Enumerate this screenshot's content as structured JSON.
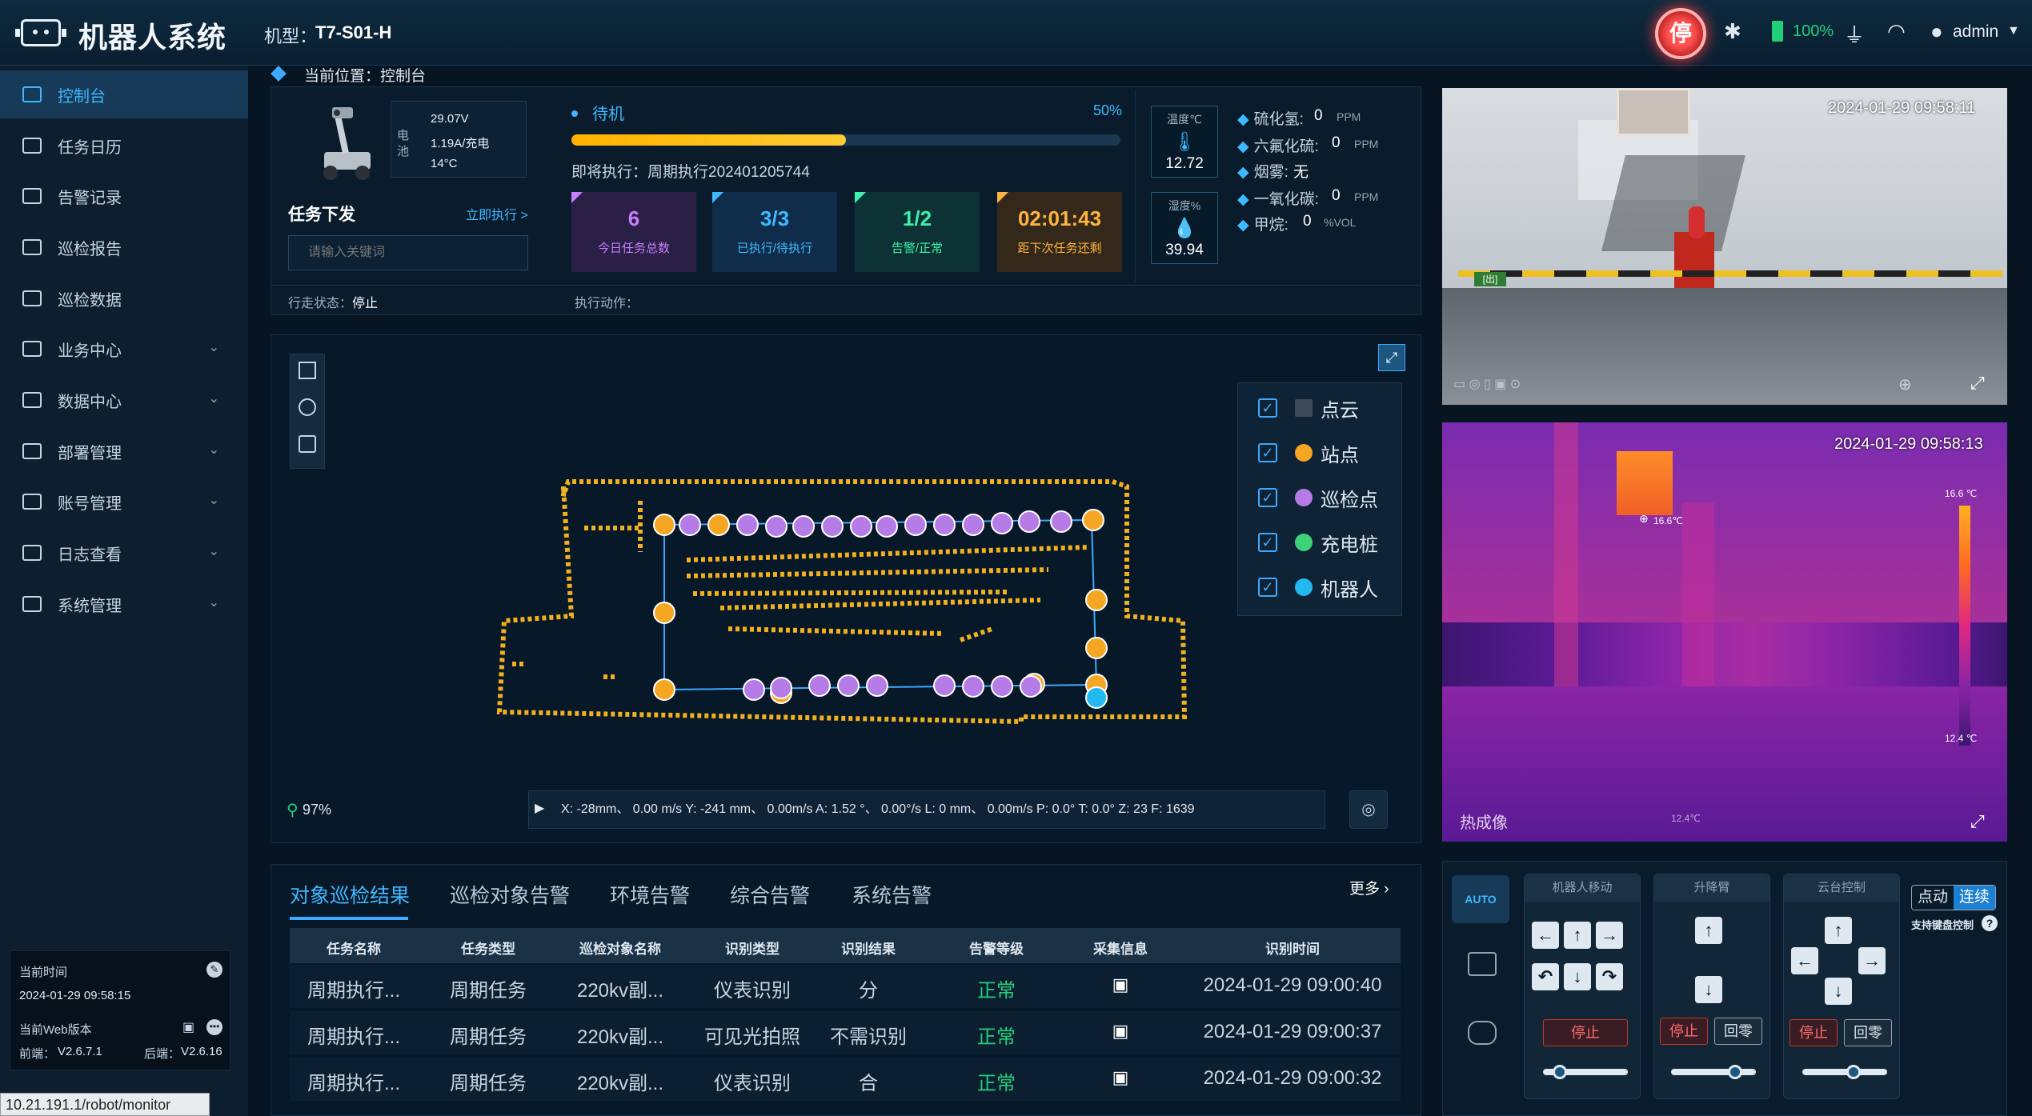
{
  "header": {
    "app_title": "机器人系统",
    "model_label": "机型：",
    "model_value": "T7-S01-H",
    "estop_label": "停",
    "battery_pct": "100%",
    "user": "admin"
  },
  "sidebar": {
    "items": [
      {
        "label": "控制台",
        "icon": "dashboard-icon",
        "active": true
      },
      {
        "label": "任务日历",
        "icon": "calendar-icon"
      },
      {
        "label": "告警记录",
        "icon": "alarm-icon"
      },
      {
        "label": "巡检报告",
        "icon": "report-icon"
      },
      {
        "label": "巡检数据",
        "icon": "data-icon"
      },
      {
        "label": "业务中心",
        "icon": "folder-icon",
        "expandable": true
      },
      {
        "label": "数据中心",
        "icon": "monitor-icon",
        "expandable": true
      },
      {
        "label": "部署管理",
        "icon": "deploy-icon",
        "expandable": true
      },
      {
        "label": "账号管理",
        "icon": "account-icon",
        "expandable": true
      },
      {
        "label": "日志查看",
        "icon": "log-icon",
        "expandable": true
      },
      {
        "label": "系统管理",
        "icon": "settings-icon",
        "expandable": true
      }
    ],
    "info": {
      "time_label": "当前时间",
      "time_value": "2024-01-29 09:58:15",
      "version_label": "当前Web版本",
      "frontend": "前端：",
      "frontend_ver": "V2.6.7.1",
      "backend": "后端：",
      "backend_ver": "V2.6.16"
    },
    "url": "10.21.191.1/robot/monitor"
  },
  "breadcrumb": "当前位置：控制台",
  "task": {
    "battery_label": "电池",
    "voltage": "29.07V",
    "current": "1.19A/充电",
    "temp": "14°C",
    "dispatch_title": "任务下发",
    "exec_now": "立即执行 >",
    "keyword_placeholder": "请输入关键词",
    "status": "待机",
    "progress_label": "50%",
    "progress": 0.5,
    "next_run": "即将执行：周期执行202401205744",
    "stats": [
      {
        "value": "6",
        "label": "今日任务总数",
        "color": "#c87dff",
        "bg": "#2a1f45"
      },
      {
        "value": "3/3",
        "label": "已执行/待执行",
        "color": "#3fb8ff",
        "bg": "#0f2d4a"
      },
      {
        "value": "1/2",
        "label": "告警/正常",
        "color": "#3ff0a8",
        "bg": "#0d3236"
      },
      {
        "value": "02:01:43",
        "label": "距下次任务还剩",
        "color": "#ffb340",
        "bg": "#33281a"
      }
    ],
    "walk_label": "行走状态：",
    "walk_value": "停止",
    "action_label": "执行动作："
  },
  "sensors": {
    "temp_label": "温度℃",
    "temp_value": "12.72",
    "humid_label": "湿度%",
    "humid_value": "39.94",
    "gases": [
      {
        "name": "硫化氢:",
        "value": "0",
        "unit": "PPM"
      },
      {
        "name": "六氟化硫:",
        "value": "0",
        "unit": "PPM"
      },
      {
        "name": "烟雾:",
        "value": "无",
        "unit": ""
      },
      {
        "name": "一氧化碳:",
        "value": "0",
        "unit": "PPM"
      },
      {
        "name": "甲烷:",
        "value": "0",
        "unit": "%VOL"
      }
    ]
  },
  "map": {
    "layers": [
      {
        "label": "点云",
        "color": "#3d4a58"
      },
      {
        "label": "站点",
        "color": "#f5a623"
      },
      {
        "label": "巡检点",
        "color": "#b57be6"
      },
      {
        "label": "充电桩",
        "color": "#3fd07a"
      },
      {
        "label": "机器人",
        "color": "#22b8f0"
      }
    ],
    "battery_level": "97%",
    "telemetry": "X:  -28mm、 0.00 m/s     Y:  -241 mm、 0.00m/s     A:  1.52 °、 0.00°/s     L:  0 mm、 0.00m/s     P:  0.0°     T:  0.0°     Z:  23     F:  1639"
  },
  "results": {
    "tabs": [
      "对象巡检结果",
      "巡检对象告警",
      "环境告警",
      "综合告警",
      "系统告警"
    ],
    "more": "更多 ›",
    "headers": [
      "任务名称",
      "任务类型",
      "巡检对象名称",
      "识别类型",
      "识别结果",
      "告警等级",
      "采集信息",
      "识别时间"
    ],
    "rows": [
      [
        "周期执行...",
        "周期任务",
        "220kv副...",
        "仪表识别",
        "分",
        "正常",
        "",
        "2024-01-29 09:00:40"
      ],
      [
        "周期执行...",
        "周期任务",
        "220kv副...",
        "可见光拍照",
        "不需识别",
        "正常",
        "",
        "2024-01-29 09:00:37"
      ],
      [
        "周期执行...",
        "周期任务",
        "220kv副...",
        "仪表识别",
        "合",
        "正常",
        "",
        "2024-01-29 09:00:32"
      ]
    ]
  },
  "cameras": {
    "visible_time": "2024-01-29 09:58:11",
    "thermal_time": "2024-01-29 09:58:13",
    "thermal_label": "热成像",
    "thermal_max": "16.6 ℃",
    "thermal_min": "12.4 ℃",
    "thermal_point": "16.6℃",
    "thermal_low": "12.4℃",
    "exit_sign": "[出]"
  },
  "control": {
    "auto": "AUTO",
    "move_title": "机器人移动",
    "lift_title": "升降臂",
    "ptz_title": "云台控制",
    "stop": "停止",
    "zero": "回零",
    "mode_a": "点动",
    "mode_b": "连续",
    "kbd_hint": "支持键盘控制",
    "move_speed": 0.2,
    "lift_speed": 0.75,
    "ptz_speed": 0.6
  }
}
